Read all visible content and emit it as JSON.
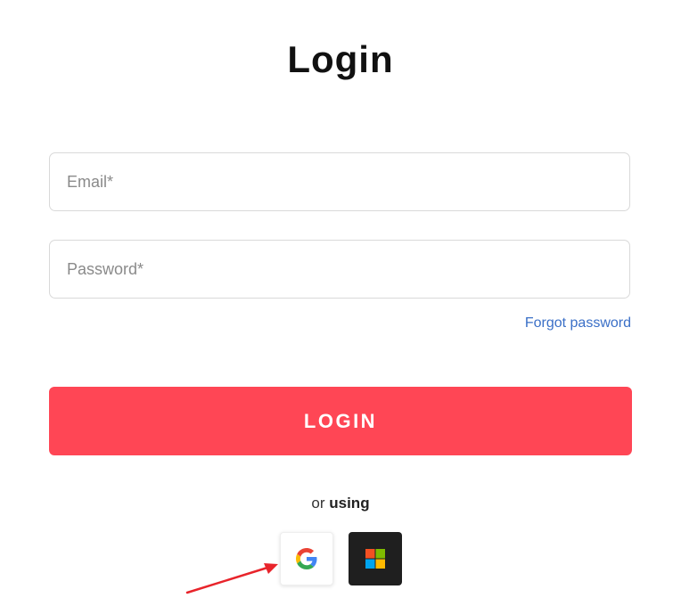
{
  "page": {
    "title": "Login"
  },
  "form": {
    "email_placeholder": "Email*",
    "email_value": "",
    "password_placeholder": "Password*",
    "password_value": "",
    "forgot_password_label": "Forgot password",
    "login_button_label": "LOGIN"
  },
  "alternate": {
    "prefix": "or",
    "emphasis": "using"
  },
  "social_logins": [
    {
      "provider_icon": "google-icon"
    },
    {
      "provider_icon": "microsoft-icon"
    }
  ],
  "colors": {
    "primary_button": "#ff4655",
    "link": "#3a6fc7",
    "microsoft_button_bg": "#1f1f1f",
    "annotation_arrow": "#e8242b"
  }
}
